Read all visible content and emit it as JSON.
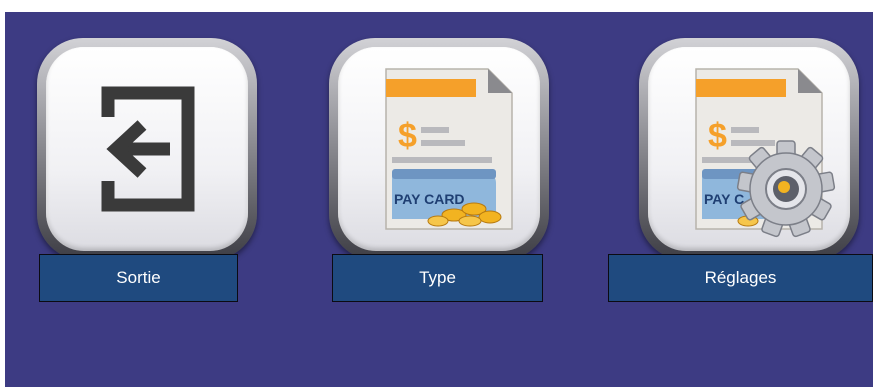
{
  "buttons": [
    {
      "label": "Sortie",
      "icon": "exit-icon"
    },
    {
      "label": "Type",
      "icon": "pay-card-document-icon",
      "icon_text": "PAY CARD"
    },
    {
      "label": "Réglages",
      "icon": "pay-card-settings-icon",
      "icon_text": "PAY C"
    }
  ],
  "colors": {
    "background": "#3d3b83",
    "label_bg": "#1f4a7f",
    "label_text": "#ffffff",
    "icon_orange": "#f5a02a",
    "icon_coin_gold": "#f2b321"
  }
}
